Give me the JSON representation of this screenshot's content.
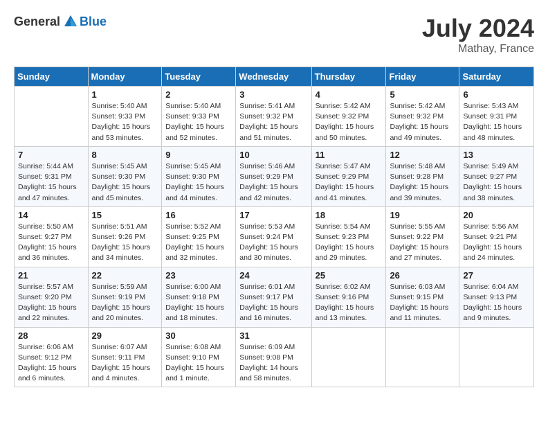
{
  "header": {
    "logo_general": "General",
    "logo_blue": "Blue",
    "title": "July 2024",
    "location": "Mathay, France"
  },
  "calendar": {
    "days_of_week": [
      "Sunday",
      "Monday",
      "Tuesday",
      "Wednesday",
      "Thursday",
      "Friday",
      "Saturday"
    ],
    "weeks": [
      [
        {
          "day": "",
          "info": ""
        },
        {
          "day": "1",
          "info": "Sunrise: 5:40 AM\nSunset: 9:33 PM\nDaylight: 15 hours\nand 53 minutes."
        },
        {
          "day": "2",
          "info": "Sunrise: 5:40 AM\nSunset: 9:33 PM\nDaylight: 15 hours\nand 52 minutes."
        },
        {
          "day": "3",
          "info": "Sunrise: 5:41 AM\nSunset: 9:32 PM\nDaylight: 15 hours\nand 51 minutes."
        },
        {
          "day": "4",
          "info": "Sunrise: 5:42 AM\nSunset: 9:32 PM\nDaylight: 15 hours\nand 50 minutes."
        },
        {
          "day": "5",
          "info": "Sunrise: 5:42 AM\nSunset: 9:32 PM\nDaylight: 15 hours\nand 49 minutes."
        },
        {
          "day": "6",
          "info": "Sunrise: 5:43 AM\nSunset: 9:31 PM\nDaylight: 15 hours\nand 48 minutes."
        }
      ],
      [
        {
          "day": "7",
          "info": "Sunrise: 5:44 AM\nSunset: 9:31 PM\nDaylight: 15 hours\nand 47 minutes."
        },
        {
          "day": "8",
          "info": "Sunrise: 5:45 AM\nSunset: 9:30 PM\nDaylight: 15 hours\nand 45 minutes."
        },
        {
          "day": "9",
          "info": "Sunrise: 5:45 AM\nSunset: 9:30 PM\nDaylight: 15 hours\nand 44 minutes."
        },
        {
          "day": "10",
          "info": "Sunrise: 5:46 AM\nSunset: 9:29 PM\nDaylight: 15 hours\nand 42 minutes."
        },
        {
          "day": "11",
          "info": "Sunrise: 5:47 AM\nSunset: 9:29 PM\nDaylight: 15 hours\nand 41 minutes."
        },
        {
          "day": "12",
          "info": "Sunrise: 5:48 AM\nSunset: 9:28 PM\nDaylight: 15 hours\nand 39 minutes."
        },
        {
          "day": "13",
          "info": "Sunrise: 5:49 AM\nSunset: 9:27 PM\nDaylight: 15 hours\nand 38 minutes."
        }
      ],
      [
        {
          "day": "14",
          "info": "Sunrise: 5:50 AM\nSunset: 9:27 PM\nDaylight: 15 hours\nand 36 minutes."
        },
        {
          "day": "15",
          "info": "Sunrise: 5:51 AM\nSunset: 9:26 PM\nDaylight: 15 hours\nand 34 minutes."
        },
        {
          "day": "16",
          "info": "Sunrise: 5:52 AM\nSunset: 9:25 PM\nDaylight: 15 hours\nand 32 minutes."
        },
        {
          "day": "17",
          "info": "Sunrise: 5:53 AM\nSunset: 9:24 PM\nDaylight: 15 hours\nand 30 minutes."
        },
        {
          "day": "18",
          "info": "Sunrise: 5:54 AM\nSunset: 9:23 PM\nDaylight: 15 hours\nand 29 minutes."
        },
        {
          "day": "19",
          "info": "Sunrise: 5:55 AM\nSunset: 9:22 PM\nDaylight: 15 hours\nand 27 minutes."
        },
        {
          "day": "20",
          "info": "Sunrise: 5:56 AM\nSunset: 9:21 PM\nDaylight: 15 hours\nand 24 minutes."
        }
      ],
      [
        {
          "day": "21",
          "info": "Sunrise: 5:57 AM\nSunset: 9:20 PM\nDaylight: 15 hours\nand 22 minutes."
        },
        {
          "day": "22",
          "info": "Sunrise: 5:59 AM\nSunset: 9:19 PM\nDaylight: 15 hours\nand 20 minutes."
        },
        {
          "day": "23",
          "info": "Sunrise: 6:00 AM\nSunset: 9:18 PM\nDaylight: 15 hours\nand 18 minutes."
        },
        {
          "day": "24",
          "info": "Sunrise: 6:01 AM\nSunset: 9:17 PM\nDaylight: 15 hours\nand 16 minutes."
        },
        {
          "day": "25",
          "info": "Sunrise: 6:02 AM\nSunset: 9:16 PM\nDaylight: 15 hours\nand 13 minutes."
        },
        {
          "day": "26",
          "info": "Sunrise: 6:03 AM\nSunset: 9:15 PM\nDaylight: 15 hours\nand 11 minutes."
        },
        {
          "day": "27",
          "info": "Sunrise: 6:04 AM\nSunset: 9:13 PM\nDaylight: 15 hours\nand 9 minutes."
        }
      ],
      [
        {
          "day": "28",
          "info": "Sunrise: 6:06 AM\nSunset: 9:12 PM\nDaylight: 15 hours\nand 6 minutes."
        },
        {
          "day": "29",
          "info": "Sunrise: 6:07 AM\nSunset: 9:11 PM\nDaylight: 15 hours\nand 4 minutes."
        },
        {
          "day": "30",
          "info": "Sunrise: 6:08 AM\nSunset: 9:10 PM\nDaylight: 15 hours\nand 1 minute."
        },
        {
          "day": "31",
          "info": "Sunrise: 6:09 AM\nSunset: 9:08 PM\nDaylight: 14 hours\nand 58 minutes."
        },
        {
          "day": "",
          "info": ""
        },
        {
          "day": "",
          "info": ""
        },
        {
          "day": "",
          "info": ""
        }
      ]
    ]
  }
}
